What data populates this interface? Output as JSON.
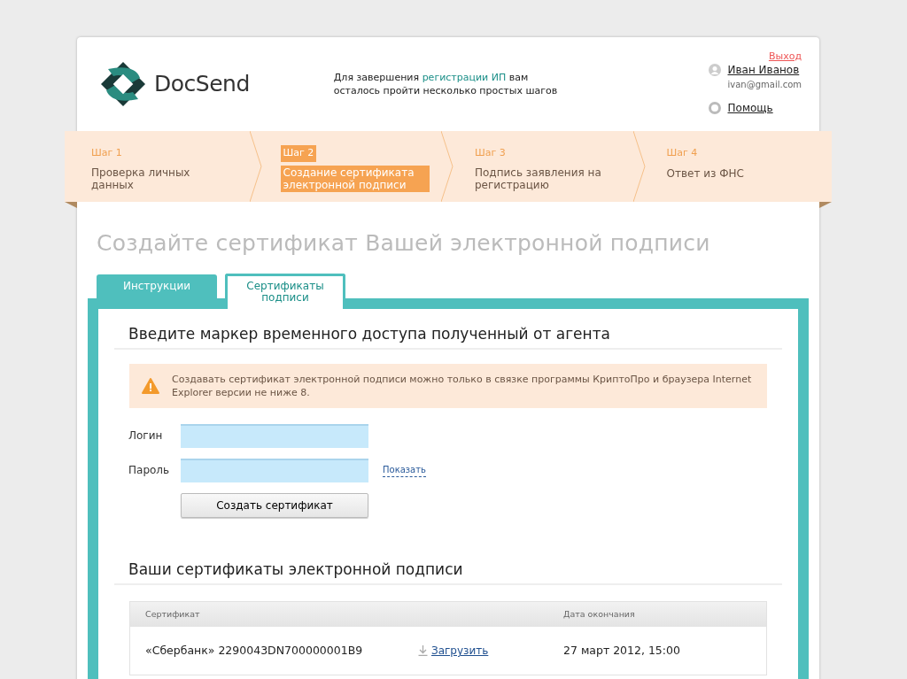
{
  "header": {
    "logo_text": "DocSend",
    "intro": {
      "before": "Для завершения ",
      "highlight": "регистрации ИП",
      "after": " вам осталось пройти несколько простых шагов"
    },
    "user": {
      "name": "Иван Иванов",
      "email": "ivan@gmail.com"
    },
    "help": "Помощь",
    "logout": "Выход"
  },
  "steps": [
    {
      "label": "Шаг 1",
      "title": "Проверка личных данных",
      "selected": false
    },
    {
      "label": "Шаг 2",
      "title": "Создание сертификата электронной подписи",
      "selected": true
    },
    {
      "label": "Шаг 3",
      "title": "Подпись заявления на регистрацию",
      "selected": false
    },
    {
      "label": "Шаг 4",
      "title": "Ответ из ФНС",
      "selected": false
    }
  ],
  "page_title": "Создайте сертификат Вашей электронной подписи",
  "tabs": [
    {
      "label": "Инструкции",
      "selected": false
    },
    {
      "label": "Сертификаты подписи",
      "selected": true
    }
  ],
  "token_section": {
    "heading": "Введите маркер временного доступа полученный от агента",
    "warning": "Создавать сертификат электронной подписи можно только в связке программы КриптоПро и браузера Internet Explorer версии не ниже 8.",
    "login_label": "Логин",
    "password_label": "Пароль",
    "show_link": "Показать",
    "submit": "Создать сертификат"
  },
  "certs_section": {
    "heading": "Ваши сертификаты электронной подписи",
    "columns": [
      "Сертификат",
      "Дата окончания"
    ],
    "rows": [
      {
        "name": "«Сбербанк» 2290043DN700000001B9",
        "download": "Загрузить",
        "expires": "27 март 2012, 15:00"
      }
    ]
  }
}
